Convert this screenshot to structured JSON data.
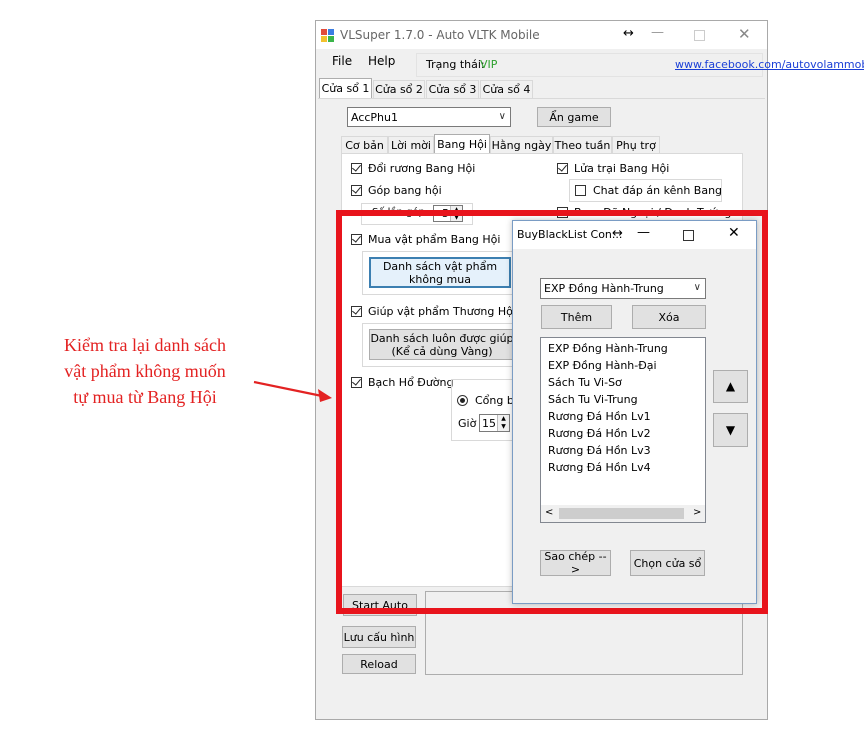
{
  "main_window": {
    "title": "VLSuper 1.7.0 - Auto VLTK Mobile",
    "menu": [
      "File",
      "Help"
    ],
    "status_label": "Trạng thái:",
    "status_value": "VIP",
    "facebook_link": "www.facebook.com/autovolammobi",
    "window_tabs": [
      "Cửa sổ 1",
      "Cửa sổ 2",
      "Cửa sổ 3",
      "Cửa sổ 4"
    ],
    "account_select": "AccPhu1",
    "hide_game_button": "Ẩn game",
    "feature_tabs": [
      "Cơ bản",
      "Lời mời",
      "Bang Hội",
      "Hằng ngày",
      "Theo tuần",
      "Phụ trợ"
    ],
    "options": {
      "doi_ruong": "Đổi rương Bang Hội",
      "lua_trai": "Lửa trại Bang Hội",
      "chat_dap_an": "Chat đáp án kênh Bang",
      "gop_bang_hoi": "Góp bang hội",
      "so_lan_gop_label": "Số lần góp",
      "so_lan_gop_value": "5",
      "boss_label": "Boss Dã Ngoại / Danh Tướng",
      "mua_vat_pham": "Mua vật phẩm Bang Hội",
      "ds_khong_mua_button": "Danh sách vật phẩm\nkhông mua",
      "giup_vat_pham": "Giúp vật phẩm Thương Hội",
      "ds_luon_giup_button": "Danh sách luôn được giúp\n(Kể cả dùng Vàng)",
      "bach_ho_duong": "Bạch Hổ Đường",
      "cong_label": "Cổng bắ",
      "gio_label": "Giờ",
      "gio_value": "15"
    },
    "start_button": "Start Auto",
    "save_config_button": "Lưu cấu hình",
    "reload_button": "Reload"
  },
  "dialog": {
    "title": "BuyBlackList Con...",
    "select_value": "EXP Đồng Hành-Trung",
    "add_button": "Thêm",
    "delete_button": "Xóa",
    "items": [
      "EXP Đồng Hành-Trung",
      "EXP Đồng Hành-Đại",
      "Sách Tu Vi-Sơ",
      "Sách Tu Vi-Trung",
      "Rương Đá Hồn Lv1",
      "Rương Đá Hồn Lv2",
      "Rương Đá Hồn Lv3",
      "Rương Đá Hồn Lv4"
    ],
    "copy_button": "Sao chép -->",
    "choose_window_button": "Chọn cửa sổ"
  },
  "annotation": {
    "text": "Kiểm tra lại danh sách\nvật phẩm không muốn\ntự mua từ Bang Hội",
    "color": "#e32222"
  }
}
